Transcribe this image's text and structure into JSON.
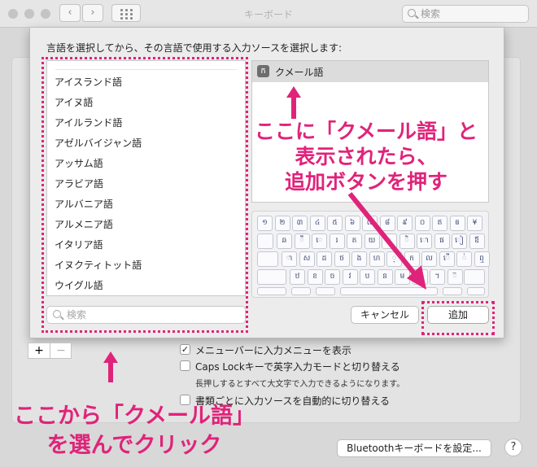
{
  "window": {
    "title": "キーボード",
    "search_placeholder": "検索",
    "nav_back": "‹",
    "nav_forward": "›"
  },
  "sheet": {
    "instruction": "言語を選択してから、その言語で使用する入力ソースを選択します:",
    "languages": [
      "アイスランド語",
      "アイヌ語",
      "アイルランド語",
      "アゼルバイジャン語",
      "アッサム語",
      "アラビア語",
      "アルバニア語",
      "アルメニア語",
      "イタリア語",
      "イヌクティトット語",
      "ウイグル語"
    ],
    "language_search_placeholder": "検索",
    "input_sources": [
      {
        "icon_glyph": "ក",
        "label": "クメール語"
      }
    ],
    "keyboard_rows": [
      [
        "១",
        "២",
        "៣",
        "៤",
        "៥",
        "៦",
        "៧",
        "៨",
        "៩",
        "០",
        "ឥ",
        "ឲ",
        "¥"
      ],
      [
        "ឆ",
        "ឹ",
        "េ",
        "រ",
        "ត",
        "យ",
        "ុ",
        "ិ",
        "ោ",
        "ផ",
        "ៀ",
        "ឪ"
      ],
      [
        "ា",
        "ស",
        "ដ",
        "ថ",
        "ង",
        "ហ",
        "្",
        "ក",
        "ល",
        "ើ",
        "់",
        "ឮ"
      ],
      [
        "ឋ",
        "ខ",
        "ច",
        "វ",
        "ប",
        "ន",
        "ម",
        "ុំ",
        "។",
        "៊"
      ]
    ],
    "cancel_label": "キャンセル",
    "add_label": "追加"
  },
  "panel": {
    "plus_label": "+",
    "minus_label": "−",
    "options": [
      {
        "label": "メニューバーに入力メニューを表示",
        "checked": true
      },
      {
        "label": "Caps Lockキーで英字入力モードと切り替える",
        "checked": false
      },
      {
        "label": "書類ごとに入力ソースを自動的に切り替える",
        "checked": false
      }
    ],
    "caps_note": "長押しするとすべて大文字で入力できるようになります。",
    "check_mark": "✓",
    "bluetooth_label": "Bluetoothキーボードを設定...",
    "help_label": "?"
  },
  "annotations": {
    "right_callout": [
      "ここに「クメール語」と",
      "表示されたら、",
      "追加ボタンを押す"
    ],
    "bottom_callout": [
      "ここから「クメール語」",
      "を選んでクリック"
    ],
    "highlight_color": "#e0237a"
  }
}
